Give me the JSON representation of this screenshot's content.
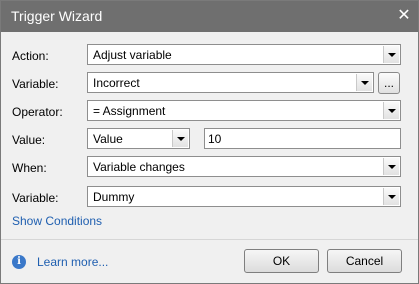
{
  "window": {
    "title": "Trigger Wizard",
    "close_glyph": "✕"
  },
  "form": {
    "action": {
      "label": "Action:",
      "value": "Adjust variable"
    },
    "variable": {
      "label": "Variable:",
      "value": "Incorrect",
      "browse_label": "..."
    },
    "operator": {
      "label": "Operator:",
      "value": "= Assignment"
    },
    "value": {
      "label": "Value:",
      "type": "Value",
      "amount": "10"
    },
    "when": {
      "label": "When:",
      "value": "Variable changes"
    },
    "when_variable": {
      "label": "Variable:",
      "value": "Dummy"
    },
    "show_conditions": "Show Conditions"
  },
  "footer": {
    "info_glyph": "i",
    "learn_more": "Learn more...",
    "ok": "OK",
    "cancel": "Cancel"
  },
  "colors": {
    "titlebar": "#6f6f6f",
    "link": "#1f5fb0",
    "info": "#3a78c9"
  }
}
